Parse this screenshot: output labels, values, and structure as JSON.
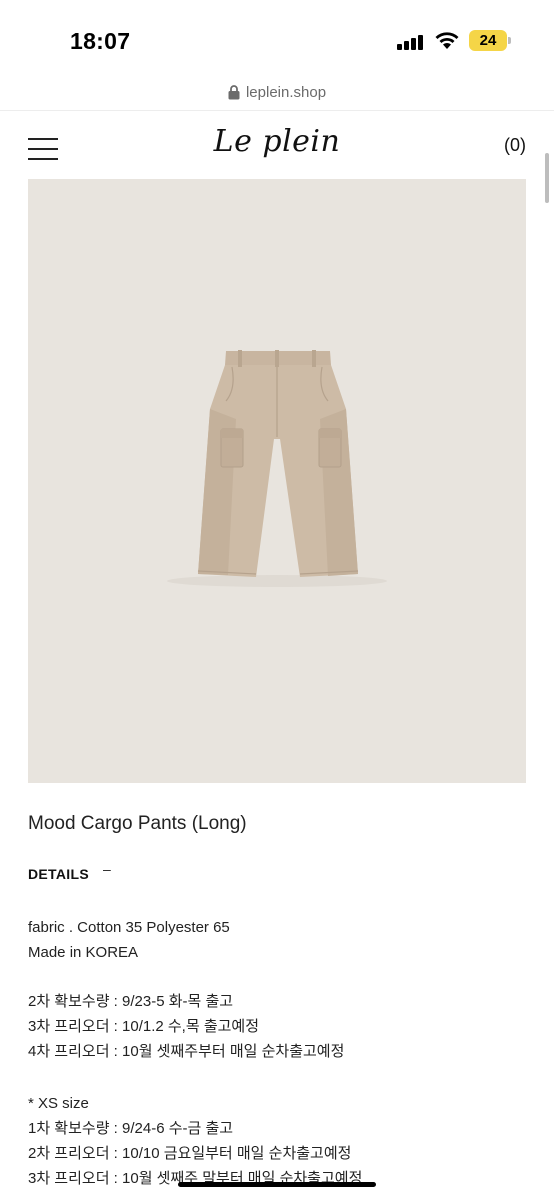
{
  "status_bar": {
    "time": "18:07",
    "battery_level": "24",
    "icons": [
      "signal-icon",
      "wifi-icon",
      "battery-icon"
    ],
    "battery_color": "#f5d547"
  },
  "url_bar": {
    "url": "leplein.shop",
    "icon": "lock-icon"
  },
  "header": {
    "logo": "Le plein",
    "cart": "(0)",
    "menu_icon": "hamburger-menu-icon"
  },
  "product": {
    "image_bg": "#e8e4de",
    "image_subject": "beige cargo pants",
    "title": "Mood Cargo Pants (Long)",
    "details_label": "DETAILS",
    "details_toggle": "–",
    "lines": [
      "fabric . Cotton 35 Polyester 65",
      "Made in KOREA",
      "2차 확보수량 : 9/23-5 화-목 출고",
      "3차 프리오더 : 10/1.2 수,목 출고예정",
      "4차 프리오더 : 10월 셋째주부터 매일 순차출고예정",
      "* XS size",
      "1차 확보수량 : 9/24-6 수-금 출고",
      "2차 프리오더 : 10/10 금요일부터 매일 순차출고예정",
      "3차 프리오더 : 10월 셋째주 말부터 매일 순차출고예정"
    ]
  }
}
